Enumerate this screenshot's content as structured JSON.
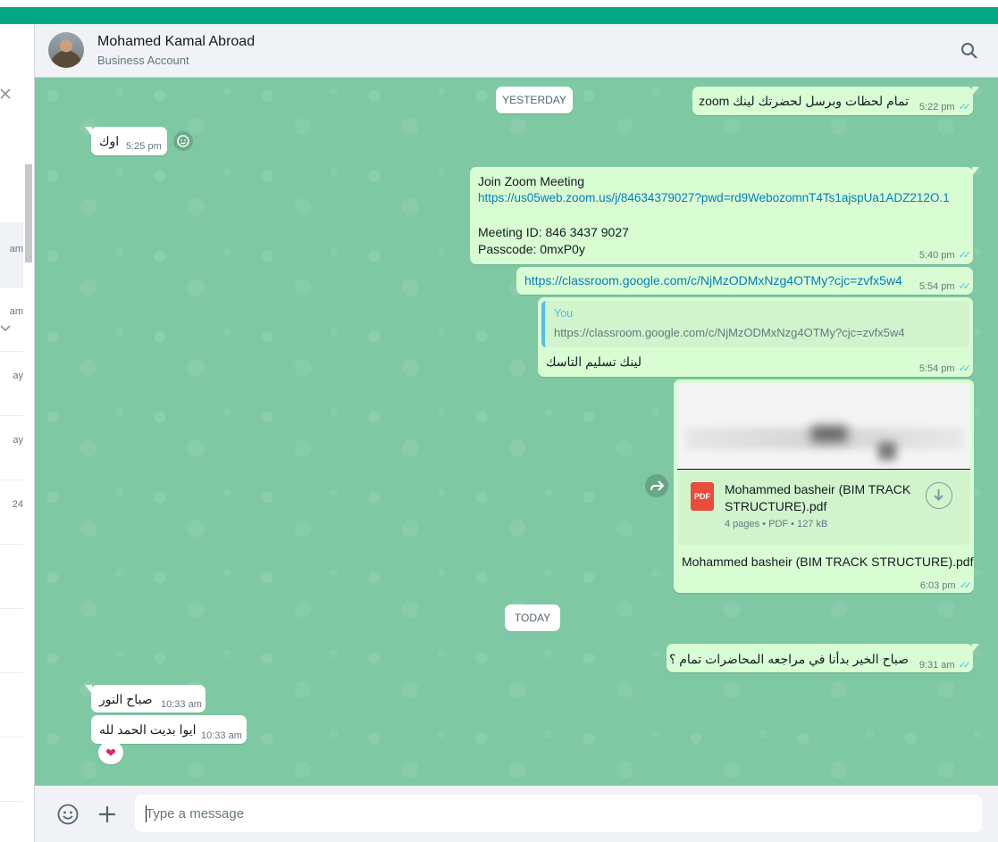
{
  "header": {
    "contact_name": "Mohamed Kamal Abroad",
    "contact_status": "Business Account",
    "avatar_icon": "contact-avatar",
    "search_icon": "search-icon"
  },
  "sidebar": {
    "close_icon": "close-icon",
    "rows": [
      {
        "text": "am"
      },
      {
        "text": "am"
      },
      {
        "text": "ay"
      },
      {
        "text": "ay"
      },
      {
        "text": "24"
      }
    ]
  },
  "chat": {
    "date_chips": {
      "yesterday": "YESTERDAY",
      "today": "TODAY"
    },
    "messages": {
      "m1": {
        "text": "تمام لحظات وبرسل لحضرتك لينك zoom",
        "time": "5:22 pm"
      },
      "m2": {
        "text": "اوك",
        "time": "5:25 pm"
      },
      "m3": {
        "line1": "Join Zoom Meeting",
        "link": "https://us05web.zoom.us/j/84634379027?pwd=rd9WebozomnT4Ts1ajspUa1ADZ212O.1",
        "line3": "Meeting ID: 846 3437 9027",
        "line4": "Passcode: 0mxP0y",
        "time": "5:40 pm"
      },
      "m4": {
        "link": "https://classroom.google.com/c/NjMzODMxNzg4OTMy?cjc=zvfx5w4",
        "time": "5:54 pm"
      },
      "m5": {
        "quote_author": "You",
        "quote_text": "https://classroom.google.com/c/NjMzODMxNzg4OTMy?cjc=zvfx5w4",
        "text": "لينك تسليم التاسك",
        "time": "5:54 pm"
      },
      "m6": {
        "file_icon_label": "PDF",
        "file_name_line1": "Mohammed basheir (BIM TRACK",
        "file_name_line2": "STRUCTURE).pdf",
        "file_meta": "4 pages • PDF • 127 kB",
        "caption": "Mohammed basheir (BIM TRACK STRUCTURE).pdf",
        "time": "6:03 pm"
      },
      "m7": {
        "text": "صباح الخير بدأنا في مراجعه المحاضرات تمام ؟",
        "time": "9:31 am"
      },
      "m8": {
        "text": "صباح النور",
        "time": "10:33 am"
      },
      "m9": {
        "text": "ايوا بديت الحمد لله",
        "time": "10:33 am"
      }
    },
    "reaction_emoji": "❤",
    "read_ticks": "✓✓"
  },
  "composer": {
    "placeholder": "Type a message",
    "value": "",
    "emoji_icon": "emoji-icon",
    "attach_icon": "plus-icon"
  },
  "colors": {
    "accent": "#00a884",
    "chat_background": "#7fc8a4",
    "outgoing_bubble": "#d9fdd3",
    "incoming_bubble": "#ffffff",
    "link": "#027eb5",
    "read_ticks": "#53bdeb"
  }
}
